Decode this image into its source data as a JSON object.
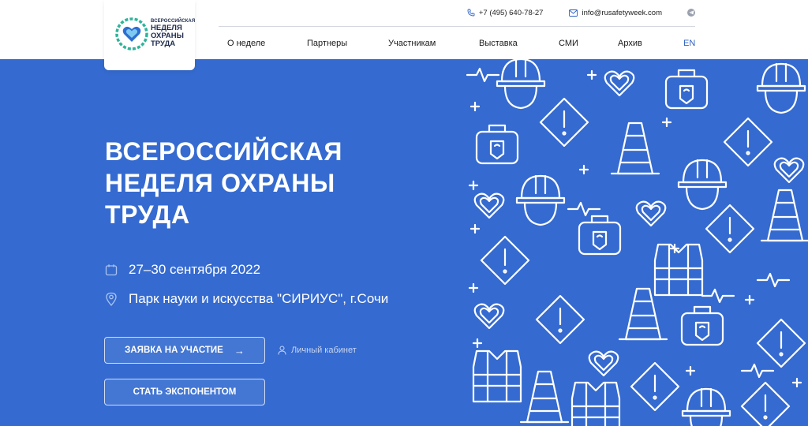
{
  "logo": {
    "line_small": "ВСЕРОССИЙСКАЯ",
    "line_1": "НЕДЕЛЯ",
    "line_2": "ОХРАНЫ",
    "line_3": "ТРУДА"
  },
  "contacts": {
    "phone": "+7 (495) 640-78-27",
    "email": "info@rusafetyweek.com"
  },
  "nav": {
    "items": [
      {
        "label": "О неделе"
      },
      {
        "label": "Партнеры"
      },
      {
        "label": "Участникам"
      },
      {
        "label": "Выставка"
      },
      {
        "label": "СМИ"
      },
      {
        "label": "Архив"
      },
      {
        "label": "EN"
      }
    ]
  },
  "hero": {
    "title_line_1": "ВСЕРОССИЙСКАЯ",
    "title_line_2": "НЕДЕЛЯ ОХРАНЫ",
    "title_line_3": "ТРУДА",
    "dates": "27–30 сентября 2022",
    "place": "Парк науки и искусства \"СИРИУС\", г.Сочи",
    "apply_button": "ЗАЯВКА НА УЧАСТИЕ",
    "apply_arrow": "→",
    "exhibit_button": "СТАТЬ ЭКСПОНЕНТОМ",
    "cabinet_link": "Личный кабинет"
  },
  "colors": {
    "hero_background": "#356bd0",
    "accent": "#2f62c0",
    "logo_green": "#2fb39a",
    "logo_blue": "#2a6fd1"
  },
  "icons": [
    "phone-icon",
    "mail-icon",
    "telegram-icon",
    "calendar-icon",
    "location-pin-icon",
    "user-icon",
    "arrow-right-icon"
  ]
}
